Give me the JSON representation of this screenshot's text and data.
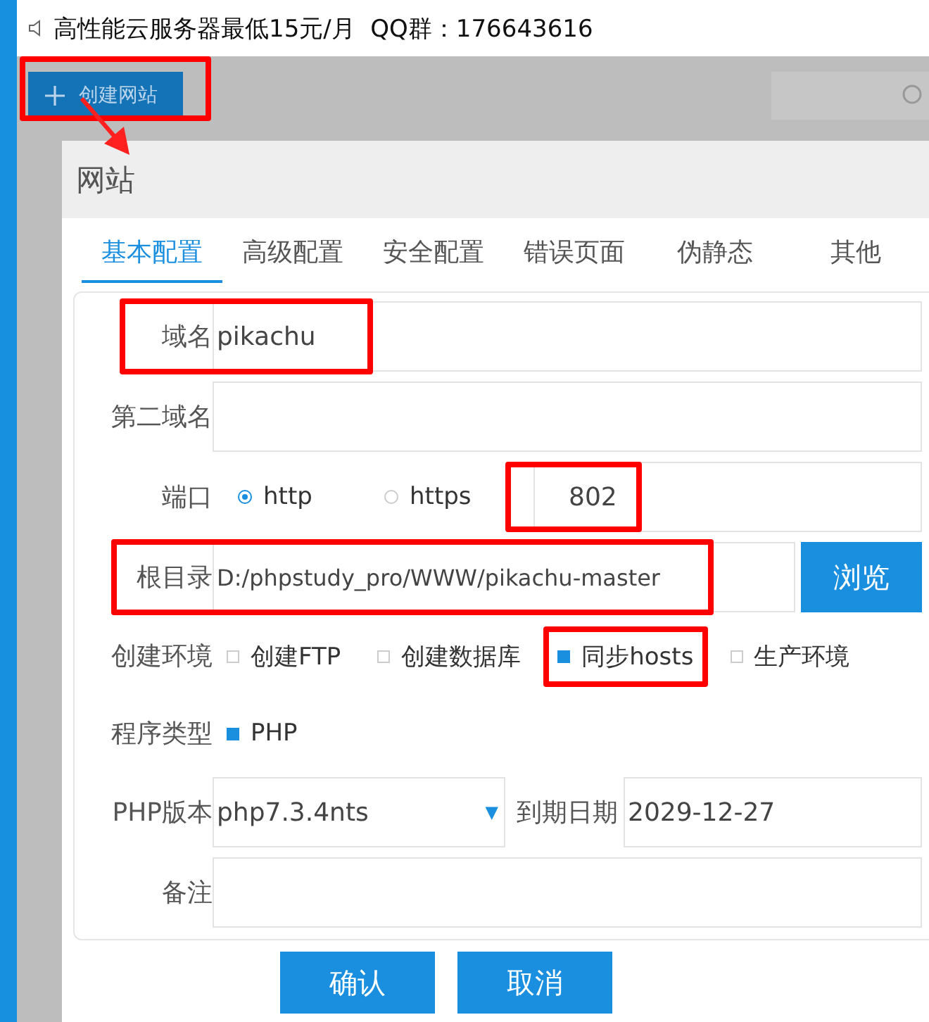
{
  "notice": {
    "text": "高性能云服务器最低15元/月  QQ群：176643616"
  },
  "toolbar": {
    "create_button": {
      "label": "创建网站",
      "highlighted": true
    },
    "annotation_arrow": true
  },
  "dialog": {
    "title": "网站",
    "tabs": [
      {
        "label": "基本配置",
        "selected": true
      },
      {
        "label": "高级配置",
        "selected": false
      },
      {
        "label": "安全配置",
        "selected": false
      },
      {
        "label": "错误页面",
        "selected": false
      },
      {
        "label": "伪静态",
        "selected": false
      },
      {
        "label": "其他",
        "selected": false
      }
    ],
    "fields": [
      {
        "kind": "text",
        "label": "域名",
        "value": "pikachu",
        "highlighted": true
      },
      {
        "kind": "text",
        "label": "第二域名",
        "highlighted": false
      },
      {
        "kind": "port",
        "label": "端口",
        "options": [
          {
            "label": "http",
            "selected": true
          },
          {
            "label": "https",
            "selected": false
          }
        ],
        "value": "802",
        "highlighted": true
      },
      {
        "kind": "path",
        "label": "根目录",
        "value": "D:/phpstudy_pro/WWW/pikachu-master",
        "button": "浏览",
        "highlighted": true
      },
      {
        "kind": "checks",
        "label": "创建环境",
        "options": [
          {
            "label": "创建FTP",
            "checked": false,
            "highlighted": false
          },
          {
            "label": "创建数据库",
            "checked": false,
            "highlighted": false
          },
          {
            "label": "同步hosts",
            "checked": true,
            "highlighted": true
          },
          {
            "label": "生产环境",
            "checked": false,
            "highlighted": false
          }
        ]
      },
      {
        "kind": "checks",
        "label": "程序类型",
        "options": [
          {
            "label": "PHP",
            "checked": true,
            "highlighted": false
          }
        ]
      },
      {
        "kind": "version",
        "label": "PHP版本",
        "value": "php7.3.4nts",
        "date_label": "到期日期",
        "date_value": "2029-12-27",
        "caret": "▼"
      },
      {
        "kind": "text",
        "label": "备注",
        "highlighted": false
      }
    ],
    "buttons": [
      "确认",
      "取消"
    ]
  }
}
